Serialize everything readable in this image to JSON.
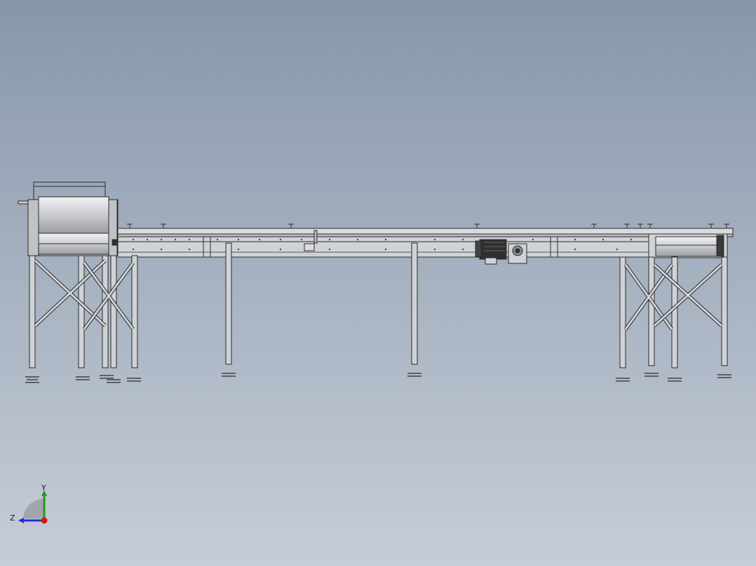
{
  "viewport": {
    "background_top": "#8a9aae",
    "background_bottom": "#c6ccd6",
    "line_color": "#2b2b2b",
    "metal_color": "#cfd2d6",
    "dark_metal": "#3a3a3a"
  },
  "model": {
    "subject": "belt-conveyor-assembly",
    "components": [
      "infeed-roller-unit",
      "main-conveyor-frame",
      "drive-motor",
      "gearbox",
      "outfeed-roller-unit",
      "support-legs",
      "leveling-feet"
    ]
  },
  "triad": {
    "y_label": "Y",
    "z_label": "Z",
    "y_color": "#1a9c1a",
    "z_color": "#1d2fd6",
    "x_color": "#d11a1a"
  }
}
